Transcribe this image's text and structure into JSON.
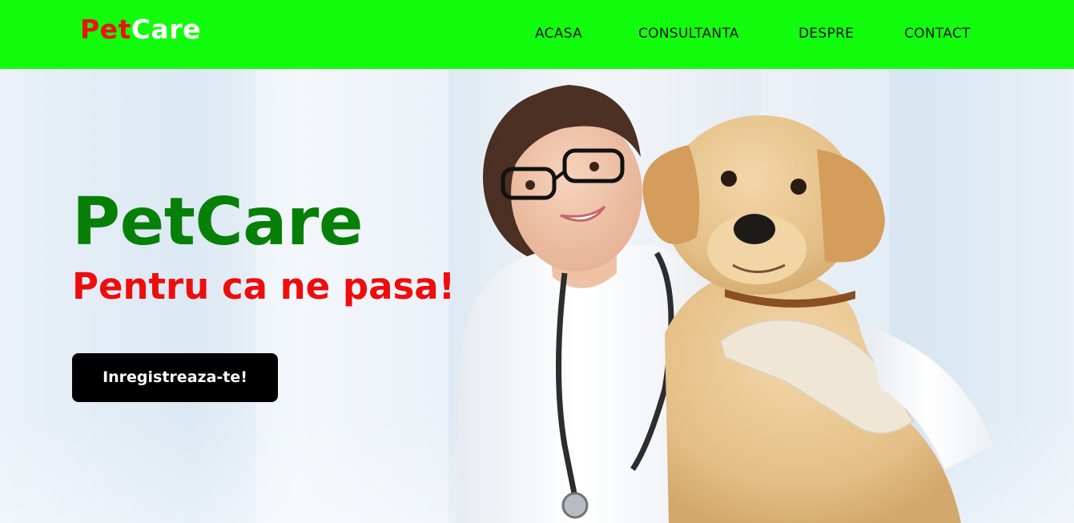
{
  "header": {
    "logo": {
      "part1": "Pet",
      "part2": "Care"
    },
    "nav": [
      {
        "label": "ACASA"
      },
      {
        "label": "CONSULTANTA"
      },
      {
        "label": "DESPRE"
      },
      {
        "label": "CONTACT"
      }
    ]
  },
  "hero": {
    "title": "PetCare",
    "subtitle": "Pentru ca ne pasa!",
    "cta_label": "Inregistreaza-te!",
    "image_alt": "veterinarian-with-labrador-puppy"
  },
  "colors": {
    "navbar": "#11fd0d",
    "logo_pet": "#ee1111",
    "logo_care": "#ffffff",
    "title": "#078007",
    "subtitle": "#ee0d0d",
    "button": "#000000"
  }
}
